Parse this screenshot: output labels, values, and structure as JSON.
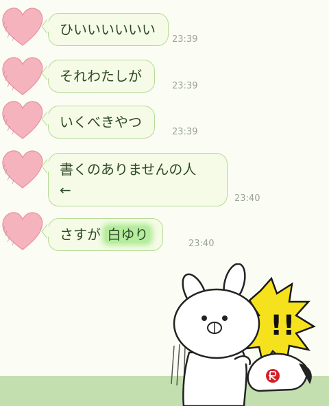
{
  "messages": [
    {
      "text": "ひいいいいいい",
      "time": "23:39"
    },
    {
      "text": "それわたしが",
      "time": "23:39"
    },
    {
      "text": "いくべきやつ",
      "time": "23:39"
    },
    {
      "line1": "書くのありませんの人",
      "line2": "←",
      "time": "23:40"
    },
    {
      "prefix": "さすが",
      "highlight": "白ゆり",
      "time": "23:40"
    }
  ],
  "sticker": {
    "exclaim": "!!"
  },
  "colors": {
    "bubble_bg": "#f5fbe6",
    "bubble_border": "#b7da97",
    "text": "#2f4a28",
    "highlight": "#b5ec9d",
    "heart": "#f5b3bd",
    "background": "#fbfcf3"
  }
}
